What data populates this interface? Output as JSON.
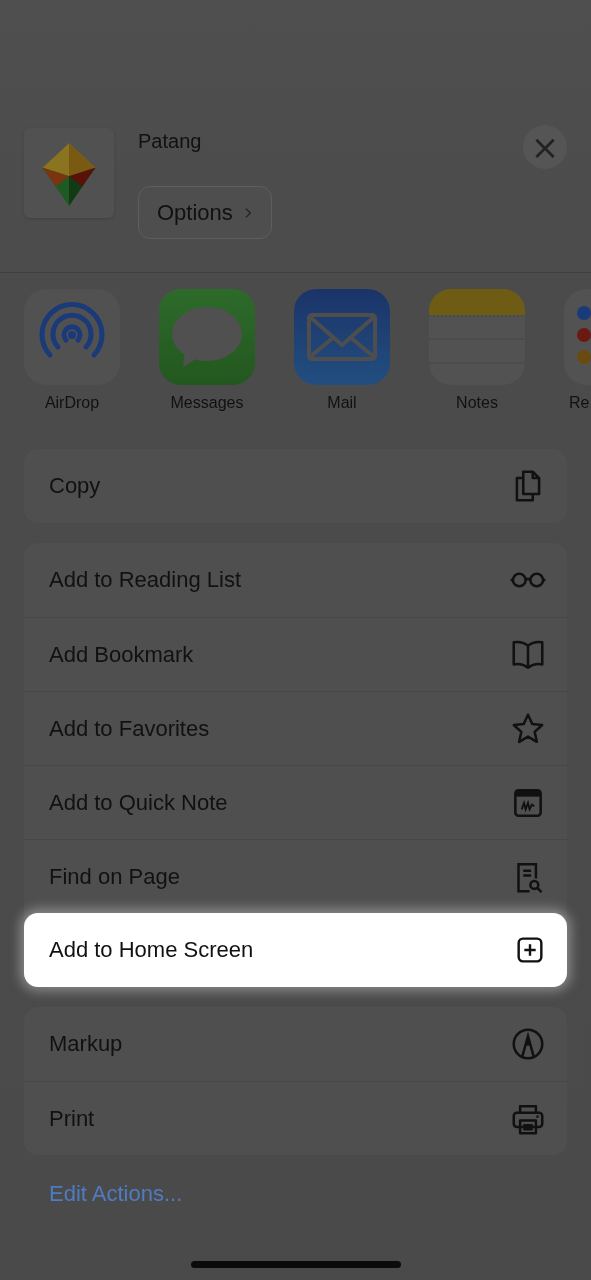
{
  "header": {
    "title": "Patang",
    "options_button": "Options",
    "close_button": "×"
  },
  "apps": [
    {
      "label": "AirDrop"
    },
    {
      "label": "Messages"
    },
    {
      "label": "Mail"
    },
    {
      "label": "Notes"
    },
    {
      "label": "Re"
    }
  ],
  "action_groups": [
    {
      "actions": [
        {
          "label": "Copy",
          "highlighted": false
        }
      ]
    },
    {
      "actions": [
        {
          "label": "Add to Reading List",
          "highlighted": false
        },
        {
          "label": "Add Bookmark",
          "highlighted": false
        },
        {
          "label": "Add to Favorites",
          "highlighted": false
        },
        {
          "label": "Add to Quick Note",
          "highlighted": false
        },
        {
          "label": "Find on Page",
          "highlighted": false
        },
        {
          "label": "Add to Home Screen",
          "highlighted": true
        }
      ]
    },
    {
      "actions": [
        {
          "label": "Markup",
          "highlighted": false
        },
        {
          "label": "Print",
          "highlighted": false
        }
      ]
    }
  ],
  "edit_actions": "Edit Actions..."
}
